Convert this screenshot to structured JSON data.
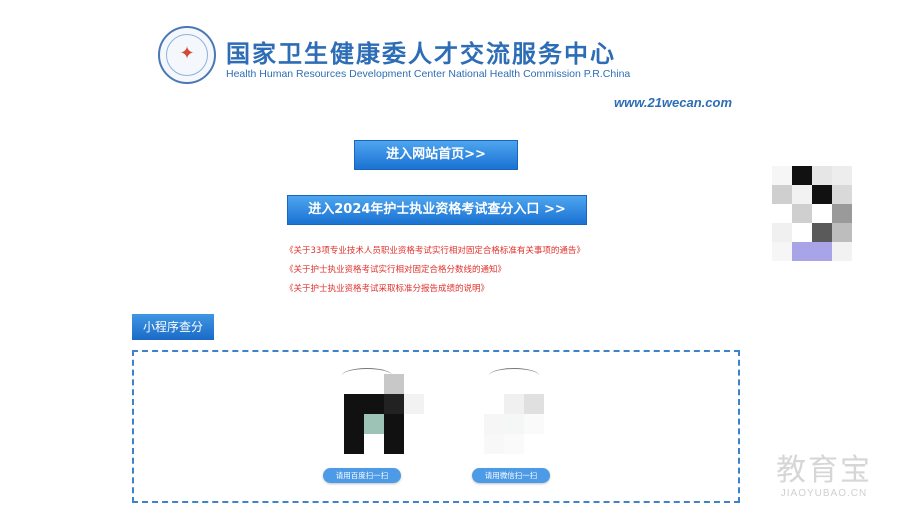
{
  "header": {
    "logo_seal_text": "国家卫生健康委人才交流服务中心",
    "title_cn": "国家卫生健康委人才交流服务中心",
    "title_en": "Health Human Resources Development Center National Health Commission P.R.China",
    "url": "www.21wecan.com"
  },
  "buttons": {
    "home": "进入网站首页>>",
    "exam": "进入2024年护士执业资格考试查分入口 >>"
  },
  "notices": [
    "《关于33项专业技术人员职业资格考试实行相对固定合格标准有关事项的通告》",
    "《关于护士执业资格考试实行相对固定合格分数线的通知》",
    "《关于护士执业资格考试采取标准分报告成绩的说明》"
  ],
  "mini_program": {
    "section_label": "小程序查分",
    "qr_left_caption": "请用百度扫一扫",
    "qr_right_caption": "请用微信扫一扫"
  },
  "watermark": {
    "cn": "教育宝",
    "en": "JIAOYUBAO.CN"
  },
  "colors": {
    "brand_blue": "#2d6db5",
    "notice_red": "#e0322c",
    "button_blue": "#1a72d2"
  }
}
